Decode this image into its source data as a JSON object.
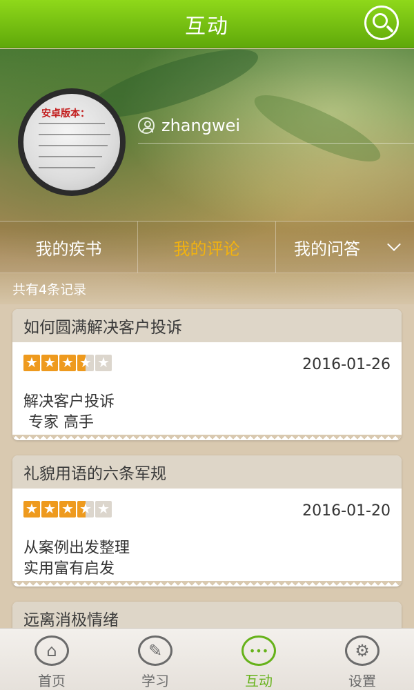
{
  "header": {
    "title": "互动"
  },
  "profile": {
    "username": "zhangwei",
    "avatar_text": "安卓版本："
  },
  "tabs": [
    {
      "label": "我的疾书",
      "active": false
    },
    {
      "label": "我的评论",
      "active": true
    },
    {
      "label": "我的问答",
      "active": false
    }
  ],
  "records": {
    "count_text": "共有4条记录"
  },
  "items": [
    {
      "title": "如何圆满解决客户投诉",
      "rating": 3.5,
      "date": "2016-01-26",
      "line1": "解决客户投诉",
      "line2": " 专家 高手"
    },
    {
      "title": "礼貌用语的六条军规",
      "rating": 3.5,
      "date": "2016-01-20",
      "line1": "从案例出发整理",
      "line2": "实用富有启发"
    },
    {
      "title": "远离消极情绪"
    }
  ],
  "nav": [
    {
      "label": "首页",
      "icon": "home-icon",
      "glyph": "⌂"
    },
    {
      "label": "学习",
      "icon": "compass-icon",
      "glyph": "✎"
    },
    {
      "label": "互动",
      "icon": "chat-icon",
      "glyph": "•••",
      "active": true
    },
    {
      "label": "设置",
      "icon": "gear-icon",
      "glyph": "⚙"
    }
  ],
  "colors": {
    "accent_green": "#66b21a",
    "tab_active": "#f2b210",
    "star": "#ee9a1e"
  }
}
